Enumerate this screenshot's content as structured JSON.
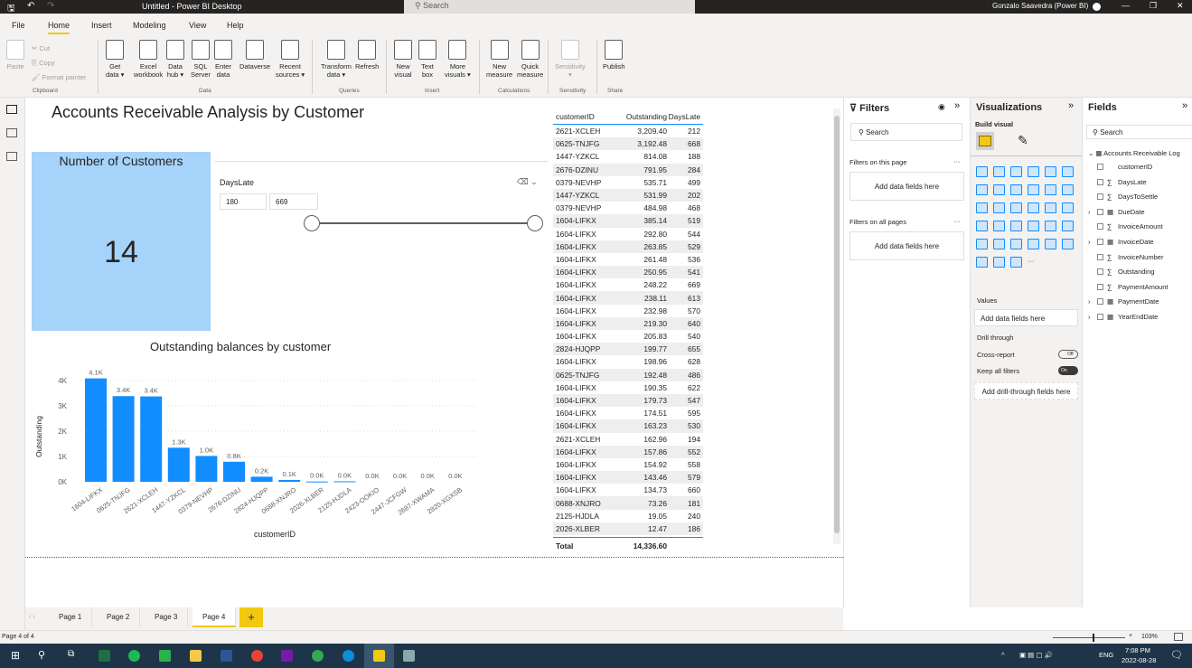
{
  "window": {
    "title": "Untitled - Power BI Desktop",
    "search_placeholder": "Search",
    "user": "Gonzalo Saavedra (Power BI)"
  },
  "menu": [
    "File",
    "Home",
    "Insert",
    "Modeling",
    "View",
    "Help"
  ],
  "active_menu": "Home",
  "ribbon": {
    "clipboard": {
      "paste": "Paste",
      "cut": "Cut",
      "copy": "Copy",
      "format_painter": "Format painter",
      "group": "Clipboard"
    },
    "data": {
      "items": [
        [
          "Get",
          "data ▾"
        ],
        [
          "Excel",
          "workbook"
        ],
        [
          "Data",
          "hub ▾"
        ],
        [
          "SQL",
          "Server"
        ],
        [
          "Enter",
          "data"
        ],
        [
          "Dataverse",
          ""
        ],
        [
          "Recent",
          "sources ▾"
        ]
      ],
      "group": "Data"
    },
    "queries": {
      "items": [
        [
          "Transform",
          "data ▾"
        ],
        [
          "Refresh",
          ""
        ]
      ],
      "group": "Queries"
    },
    "insert": {
      "items": [
        [
          "New",
          "visual"
        ],
        [
          "Text",
          "box"
        ],
        [
          "More",
          "visuals ▾"
        ]
      ],
      "group": "Insert"
    },
    "calculations": {
      "items": [
        [
          "New",
          "measure"
        ],
        [
          "Quick",
          "measure"
        ]
      ],
      "group": "Calculations"
    },
    "sensitivity": {
      "items": [
        [
          "Sensitivity",
          "▾"
        ]
      ],
      "group": "Sensitivity"
    },
    "share": {
      "items": [
        [
          "Publish",
          ""
        ]
      ],
      "group": "Share"
    }
  },
  "report": {
    "title": "Accounts Receivable Analysis by Customer",
    "card": {
      "title": "Number of Customers",
      "value": "14",
      "color": "#a6d3fa"
    },
    "slicer": {
      "field": "DaysLate",
      "min": "180",
      "max": "669"
    },
    "table": {
      "headers": [
        "customerID",
        "Outstanding",
        "DaysLate"
      ],
      "sort_column": "Outstanding",
      "rows": [
        [
          "2621-XCLEH",
          "3,209.40",
          "212"
        ],
        [
          "0625-TNJFG",
          "3,192.48",
          "668"
        ],
        [
          "1447-YZKCL",
          "814.08",
          "188"
        ],
        [
          "2676-DZINU",
          "791.95",
          "284"
        ],
        [
          "0379-NEVHP",
          "535.71",
          "499"
        ],
        [
          "1447-YZKCL",
          "531.99",
          "202"
        ],
        [
          "0379-NEVHP",
          "484.98",
          "468"
        ],
        [
          "1604-LIFKX",
          "385.14",
          "519"
        ],
        [
          "1604-LIFKX",
          "292.80",
          "544"
        ],
        [
          "1604-LIFKX",
          "263.85",
          "529"
        ],
        [
          "1604-LIFKX",
          "261.48",
          "536"
        ],
        [
          "1604-LIFKX",
          "250.95",
          "541"
        ],
        [
          "1604-LIFKX",
          "248.22",
          "669"
        ],
        [
          "1604-LIFKX",
          "238.11",
          "613"
        ],
        [
          "1604-LIFKX",
          "232.98",
          "570"
        ],
        [
          "1604-LIFKX",
          "219.30",
          "640"
        ],
        [
          "1604-LIFKX",
          "205.83",
          "540"
        ],
        [
          "2824-HJQPP",
          "199.77",
          "655"
        ],
        [
          "1604-LIFKX",
          "198.96",
          "628"
        ],
        [
          "0625-TNJFG",
          "192.48",
          "486"
        ],
        [
          "1604-LIFKX",
          "190.35",
          "622"
        ],
        [
          "1604-LIFKX",
          "179.73",
          "547"
        ],
        [
          "1604-LIFKX",
          "174.51",
          "595"
        ],
        [
          "1604-LIFKX",
          "163.23",
          "530"
        ],
        [
          "2621-XCLEH",
          "162.96",
          "194"
        ],
        [
          "1604-LIFKX",
          "157.86",
          "552"
        ],
        [
          "1604-LIFKX",
          "154.92",
          "558"
        ],
        [
          "1604-LIFKX",
          "143.46",
          "579"
        ],
        [
          "1604-LIFKX",
          "134.73",
          "660"
        ],
        [
          "0688-XNJRO",
          "73.26",
          "181"
        ],
        [
          "2125-HJDLA",
          "19.05",
          "240"
        ],
        [
          "2026-XLBER",
          "12.47",
          "186"
        ]
      ],
      "total_label": "Total",
      "total": "14,336.60"
    }
  },
  "chart_data": {
    "type": "bar",
    "title": "Outstanding balances by customer",
    "xlabel": "customerID",
    "ylabel": "Outstanding",
    "categories": [
      "1604-LIFKX",
      "0625-TNJFG",
      "2621-XCLEH",
      "1447-YZKCL",
      "0379-NEVHP",
      "2676-DZINU",
      "2824-HJQPP",
      "0688-XNJRO",
      "2026-XLBER",
      "2125-HJDLA",
      "2423-OOKIO",
      "2447-JCFGW",
      "2687-XWAMA",
      "2820-XGXSB"
    ],
    "values": [
      4086,
      3385,
      3372,
      1346,
      1021,
      792,
      200,
      73,
      12,
      19,
      0,
      0,
      0,
      0
    ],
    "data_labels": [
      "4.1K",
      "3.4K",
      "3.4K",
      "1.3K",
      "1.0K",
      "0.8K",
      "0.2K",
      "0.1K",
      "0.0K",
      "0.0K",
      "0.0K",
      "0.0K",
      "0.0K",
      "0.0K"
    ],
    "yticks": [
      "0K",
      "1K",
      "2K",
      "3K",
      "4K"
    ],
    "ylim": [
      0,
      4000
    ],
    "grid": true,
    "color": "#118dff"
  },
  "filters": {
    "title": "Filters",
    "search": "Search",
    "on_page": "Filters on this page",
    "on_all": "Filters on all pages",
    "add": "Add data fields here"
  },
  "visualizations": {
    "title": "Visualizations",
    "build": "Build visual",
    "values": "Values",
    "add": "Add data fields here",
    "drill": "Drill through",
    "cross": "Cross-report",
    "cross_state": "Off",
    "keep": "Keep all filters",
    "keep_state": "On",
    "add_drill": "Add drill-through fields here",
    "more": "···"
  },
  "fields": {
    "title": "Fields",
    "search": "Search",
    "table": "Accounts Receivable Log",
    "items": [
      {
        "name": "customerID",
        "icon": ""
      },
      {
        "name": "DaysLate",
        "icon": "∑"
      },
      {
        "name": "DaysToSettle",
        "icon": "∑"
      },
      {
        "name": "DueDate",
        "icon": "cal",
        "exp": true
      },
      {
        "name": "InvoiceAmount",
        "icon": "∑"
      },
      {
        "name": "InvoiceDate",
        "icon": "cal",
        "exp": true
      },
      {
        "name": "InvoiceNumber",
        "icon": "∑"
      },
      {
        "name": "Outstanding",
        "icon": "∑"
      },
      {
        "name": "PaymentAmount",
        "icon": "∑"
      },
      {
        "name": "PaymentDate",
        "icon": "cal",
        "exp": true
      },
      {
        "name": "YearEndDate",
        "icon": "cal",
        "exp": true
      }
    ]
  },
  "pages": [
    "Page 1",
    "Page 2",
    "Page 3",
    "Page 4"
  ],
  "active_page": "Page 4",
  "status": {
    "page": "Page 4 of 4",
    "zoom": "103%"
  },
  "taskbar": {
    "lang": "ENG",
    "time": "7:08 PM",
    "date": "2022-08-28"
  }
}
